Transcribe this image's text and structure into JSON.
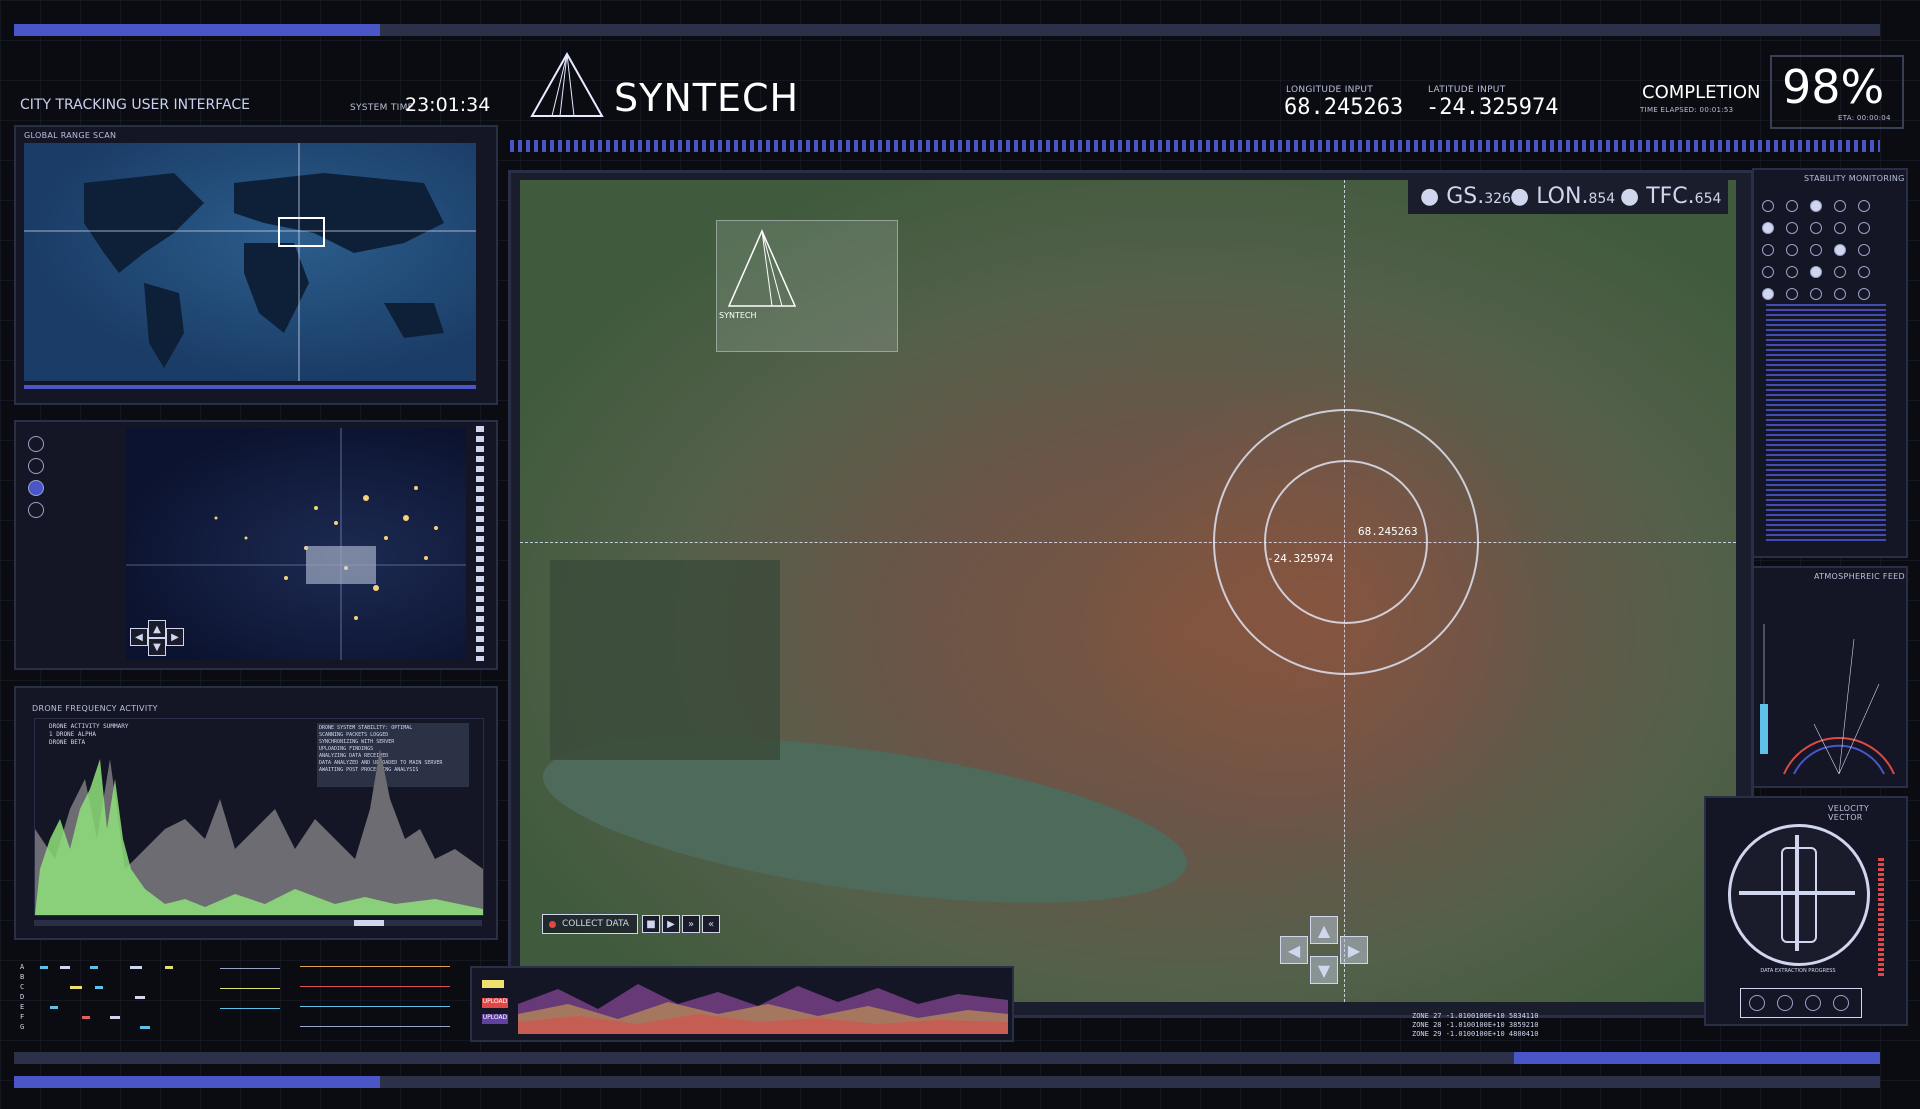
{
  "header": {
    "app_title": "CITY TRACKING USER INTERFACE",
    "system_time_label": "SYSTEM TIME",
    "system_time": "23:01:34",
    "brand": "SYNTECH",
    "longitude_label": "LONGITUDE INPUT",
    "longitude_value": "68.245263",
    "latitude_label": "LATITUDE INPUT",
    "latitude_value": "-24.325974",
    "completion_label": "COMPLETION",
    "completion_value": "98%",
    "time_elapsed": "TIME ELAPSED: 00:01:53",
    "eta": "ETA: 00:00:04"
  },
  "left": {
    "global_scan_label": "GLOBAL RANGE SCAN",
    "drone_label": "DRONE FREQUENCY ACTIVITY",
    "drone_summary": [
      "DRONE ACTIVITY SUMMARY",
      "1 DRONE ALPHA",
      "DRONE BETA"
    ],
    "drone_notes": [
      "DRONE SYSTEM STABILITY: OPTIMAL",
      "SCANNING PACKETS LOGGED",
      "SYNCHRONIZING WITH SERVER",
      "UPLOADING FINDINGS",
      "ANALYZING DATA RECEIVED",
      "DATA ANALYZED AND UPLOADED TO MAIN SERVER",
      "AWAITING POST PROCESSING ANALYSIS"
    ],
    "row_letters": [
      "A",
      "B",
      "C",
      "D",
      "E",
      "F",
      "G"
    ]
  },
  "map": {
    "stats": [
      {
        "key": "GS.",
        "val": "326"
      },
      {
        "key": "LON.",
        "val": "854"
      },
      {
        "key": "TFC.",
        "val": "654"
      }
    ],
    "target_lon": "68.245263",
    "target_lat": "-24.325974",
    "collect_label": "COLLECT DATA",
    "overlay_brand": "SYNTECH"
  },
  "right": {
    "stability_label": "STABILITY MONITORING",
    "atmospheric_label": "ATMOSPHEREIC FEED",
    "velocity_label": "VELOCITY VECTOR",
    "velocity_center": "DATA EXTRACTION PROGRESS"
  },
  "footer": {
    "upload_labels": [
      "UPLOAD",
      "UPLOAD"
    ],
    "readouts": [
      "ZONE 27   -1.0100100E+10   5834110",
      "ZONE 28   -1.0100100E+10   3859210",
      "ZONE 29   -1.0100100E+10   4800410"
    ]
  },
  "colors": {
    "accent": "#4a56c8",
    "panel": "#141626",
    "green": "#8fe07a"
  }
}
